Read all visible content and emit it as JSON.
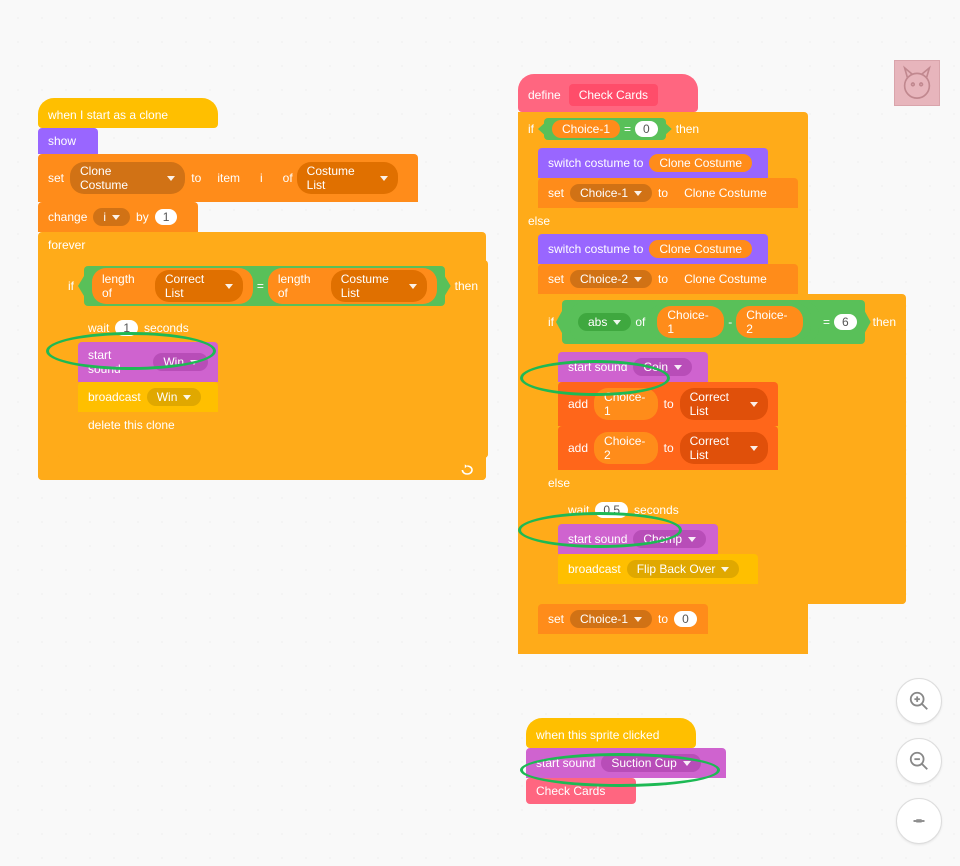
{
  "hats": {
    "clone_start": "when I start as a clone",
    "sprite_clicked": "when this sprite clicked",
    "define": "define"
  },
  "myblocks": {
    "check_cards": "Check Cards"
  },
  "looks": {
    "show": "show",
    "switch_costume_to": "switch costume to"
  },
  "data": {
    "set": "set",
    "to": "to",
    "change": "change",
    "by": "by",
    "add": "add",
    "to_list": "to",
    "item": "item",
    "of": "of",
    "length_of": "length of",
    "vars": {
      "clone_costume": "Clone Costume",
      "i": "i",
      "choice1": "Choice-1",
      "choice2": "Choice-2"
    },
    "lists": {
      "costume": "Costume List",
      "correct": "Correct List"
    }
  },
  "control": {
    "forever": "forever",
    "if": "if",
    "then": "then",
    "else": "else",
    "wait": "wait",
    "seconds": "seconds",
    "delete_clone": "delete this clone"
  },
  "events": {
    "broadcast": "broadcast",
    "msgs": {
      "win": "Win",
      "flip_back": "Flip Back Over"
    }
  },
  "sound": {
    "start_sound": "start sound",
    "sounds": {
      "win": "Win",
      "coin": "Coin",
      "chomp": "Chomp",
      "suction": "Suction Cup"
    }
  },
  "operators": {
    "eq": "=",
    "minus": "-",
    "abs": "abs",
    "of": "of"
  },
  "numbers": {
    "one": "1",
    "zero": "0",
    "half": "0.5",
    "six": "6"
  }
}
